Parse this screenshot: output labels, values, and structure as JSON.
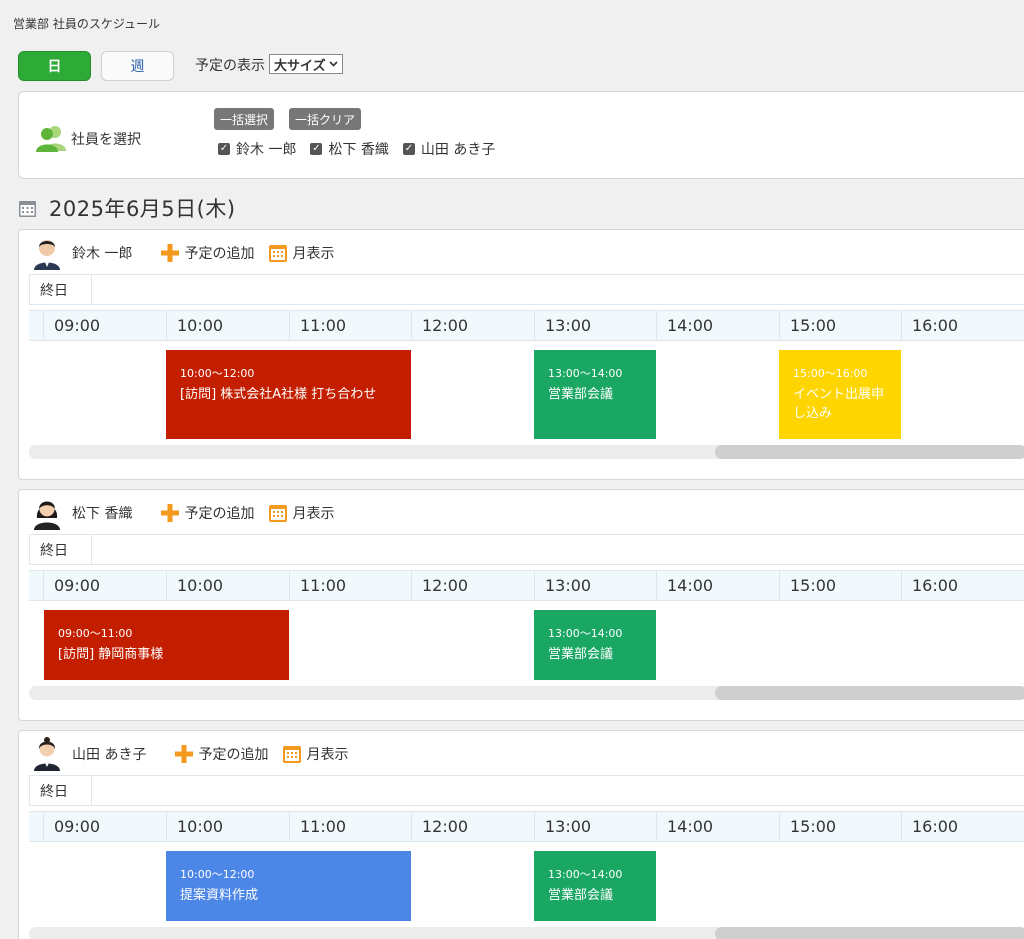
{
  "breadcrumb": "営業部  社員のスケジュール",
  "view": {
    "day_label": "日",
    "week_label": "週"
  },
  "display": {
    "label": "予定の表示",
    "size": "大サイズ"
  },
  "picker": {
    "label": "社員を選択",
    "select_all": "一括選択",
    "clear_all": "一括クリア",
    "employees": [
      "鈴木  一郎",
      "松下  香織",
      "山田  あき子"
    ]
  },
  "date": "2025年6月5日(木)",
  "labels": {
    "add": "予定の追加",
    "month": "月表示",
    "allday": "終日"
  },
  "hours": [
    "09:00",
    "10:00",
    "11:00",
    "12:00",
    "13:00",
    "14:00",
    "15:00",
    "16:00"
  ],
  "colors": {
    "visit": "#c41e00",
    "meeting": "#1aa764",
    "event": "#ffd500",
    "work": "#4c86e6",
    "active": "#2eaa36"
  },
  "schedules": [
    {
      "name": "鈴木  一郎",
      "events": [
        {
          "time": "10:00〜12:00",
          "title": "[訪問] 株式会社A社様 打ち合わせ"
        },
        {
          "time": "13:00〜14:00",
          "title": "営業部会議"
        },
        {
          "time": "15:00〜16:00",
          "title": "イベント出展申し込み"
        }
      ]
    },
    {
      "name": "松下  香織",
      "events": [
        {
          "time": "09:00〜11:00",
          "title": "[訪問] 静岡商事様"
        },
        {
          "time": "13:00〜14:00",
          "title": "営業部会議"
        }
      ]
    },
    {
      "name": "山田  あき子",
      "events": [
        {
          "time": "10:00〜12:00",
          "title": "提案資料作成"
        },
        {
          "time": "13:00〜14:00",
          "title": "営業部会議"
        }
      ]
    }
  ]
}
